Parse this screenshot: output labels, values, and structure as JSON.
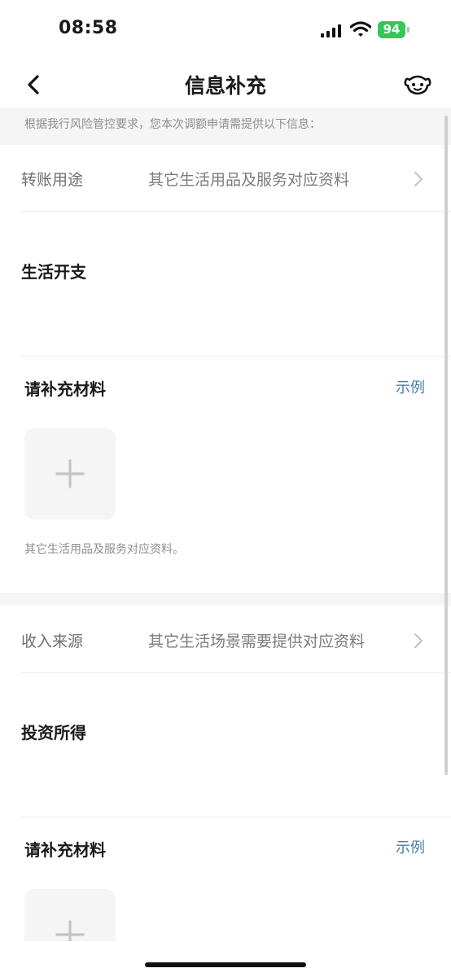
{
  "status_bar": {
    "time": "08:58",
    "battery": "94"
  },
  "nav": {
    "title": "信息补充"
  },
  "notice": {
    "text": "根据我行风险管控要求，您本次调额申请需提供以下信息："
  },
  "section1": {
    "row_label": "转账用途",
    "row_value": "其它生活用品及服务对应资料",
    "selected_text": "生活开支",
    "materials_title": "请补充材料",
    "example_link": "示例",
    "hint": "其它生活用品及服务对应资料。"
  },
  "section2": {
    "row_label": "收入来源",
    "row_value": "其它生活场景需要提供对应资料",
    "selected_text": "投资所得",
    "materials_title": "请补充材料",
    "example_link": "示例"
  },
  "icons": {
    "back": "chevron-left-icon",
    "assistant": "robot-dog-icon",
    "chevron": "chevron-right-icon",
    "plus": "plus-icon"
  },
  "colors": {
    "link": "#4a7fa6",
    "battery": "#34c759",
    "background_band": "#f5f5f5"
  }
}
